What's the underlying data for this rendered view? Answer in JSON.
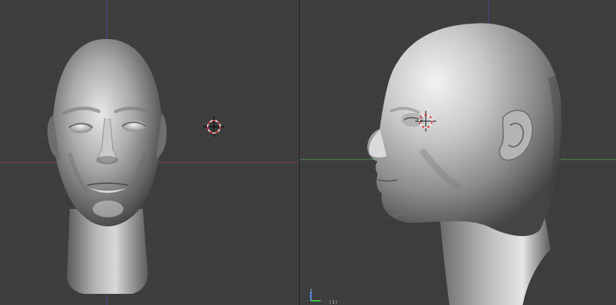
{
  "viewports": [
    {
      "name": "front",
      "view": "front-ortho"
    },
    {
      "name": "side",
      "view": "right-ortho"
    }
  ],
  "axis_gizmo": {
    "z_label": "z",
    "frame_label": "(1)"
  },
  "colors": {
    "background": "#3d3d3d",
    "grid_minor": "#464646",
    "grid_major": "#4f4f4f",
    "x_axis": "#9a4848",
    "y_axis": "#4f9a4f",
    "z_axis": "#4a4a9e",
    "cursor_red": "#e02020",
    "cursor_white": "#ffffff"
  },
  "icons": [
    "3d-cursor-icon",
    "axis-gizmo-icon"
  ]
}
